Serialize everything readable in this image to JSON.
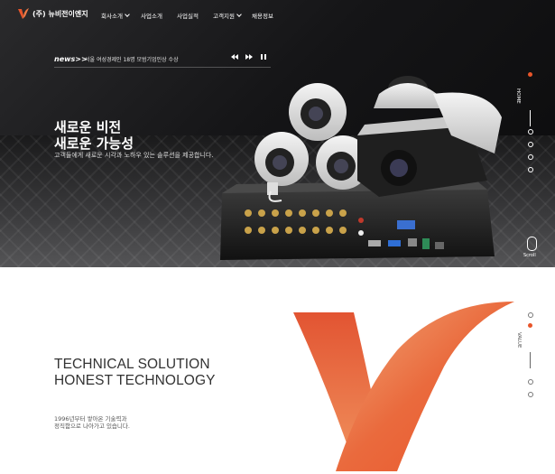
{
  "header": {
    "company_name": "(주) 뉴비전이엔지",
    "menu": [
      {
        "label": "회사소개",
        "has_dropdown": true
      },
      {
        "label": "사업소개",
        "has_dropdown": false
      },
      {
        "label": "사업실적",
        "has_dropdown": false
      },
      {
        "label": "고객지원",
        "has_dropdown": true
      },
      {
        "label": "채용정보",
        "has_dropdown": false
      }
    ]
  },
  "news": {
    "label": "news>>",
    "headline": "서울 여성경제인 18명 모범기업인상 수상",
    "controls": [
      "prev-icon",
      "next-icon",
      "pause-icon"
    ]
  },
  "hero": {
    "title_line1": "새로운 비전",
    "title_line2": "새로운 가능성",
    "subtitle": "고객들에게 새로운 시각과 노하우 있는 솔루션을 제공합니다.",
    "side_label": "HOME",
    "scroll_label": "Scroll"
  },
  "value": {
    "title_line1": "TECHNICAL SOLUTION",
    "title_line2": "HONEST TECHNOLOGY",
    "sub_line1": "1996년부터 쌓아온 기술력과",
    "sub_line2": "정직함으로 나아가고 있습니다.",
    "side_label": "VALUE"
  },
  "colors": {
    "accent": "#e8552a",
    "logo_gradient_top": "#e9603a",
    "logo_gradient_bottom": "#f3a06a"
  }
}
